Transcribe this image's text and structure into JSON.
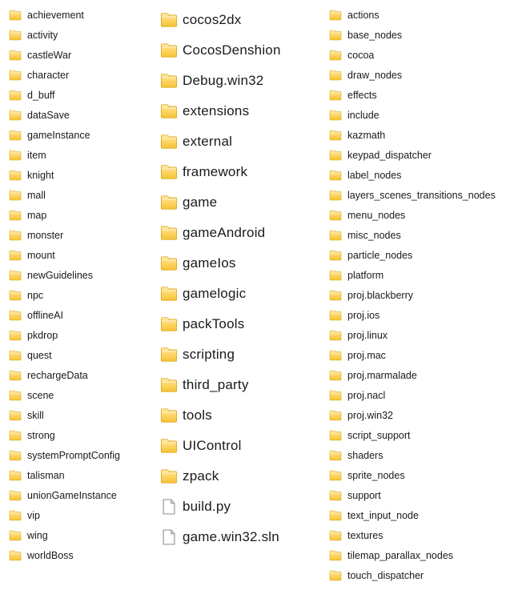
{
  "columns": [
    {
      "id": "col-1",
      "items": [
        {
          "name": "achievement",
          "type": "folder"
        },
        {
          "name": "activity",
          "type": "folder"
        },
        {
          "name": "castleWar",
          "type": "folder"
        },
        {
          "name": "character",
          "type": "folder"
        },
        {
          "name": "d_buff",
          "type": "folder"
        },
        {
          "name": "dataSave",
          "type": "folder"
        },
        {
          "name": "gameInstance",
          "type": "folder"
        },
        {
          "name": "item",
          "type": "folder"
        },
        {
          "name": "knight",
          "type": "folder"
        },
        {
          "name": "mall",
          "type": "folder"
        },
        {
          "name": "map",
          "type": "folder"
        },
        {
          "name": "monster",
          "type": "folder"
        },
        {
          "name": "mount",
          "type": "folder"
        },
        {
          "name": "newGuidelines",
          "type": "folder"
        },
        {
          "name": "npc",
          "type": "folder"
        },
        {
          "name": "offlineAI",
          "type": "folder"
        },
        {
          "name": "pkdrop",
          "type": "folder"
        },
        {
          "name": "quest",
          "type": "folder"
        },
        {
          "name": "rechargeData",
          "type": "folder"
        },
        {
          "name": "scene",
          "type": "folder"
        },
        {
          "name": "skill",
          "type": "folder"
        },
        {
          "name": "strong",
          "type": "folder"
        },
        {
          "name": "systemPromptConfig",
          "type": "folder"
        },
        {
          "name": "talisman",
          "type": "folder"
        },
        {
          "name": "unionGameInstance",
          "type": "folder"
        },
        {
          "name": "vip",
          "type": "folder"
        },
        {
          "name": "wing",
          "type": "folder"
        },
        {
          "name": "worldBoss",
          "type": "folder"
        }
      ]
    },
    {
      "id": "col-2",
      "items": [
        {
          "name": "cocos2dx",
          "type": "folder"
        },
        {
          "name": "CocosDenshion",
          "type": "folder"
        },
        {
          "name": "Debug.win32",
          "type": "folder"
        },
        {
          "name": "extensions",
          "type": "folder"
        },
        {
          "name": "external",
          "type": "folder"
        },
        {
          "name": "framework",
          "type": "folder"
        },
        {
          "name": "game",
          "type": "folder"
        },
        {
          "name": "gameAndroid",
          "type": "folder"
        },
        {
          "name": "gameIos",
          "type": "folder"
        },
        {
          "name": "gamelogic",
          "type": "folder"
        },
        {
          "name": "packTools",
          "type": "folder"
        },
        {
          "name": "scripting",
          "type": "folder"
        },
        {
          "name": "third_party",
          "type": "folder"
        },
        {
          "name": "tools",
          "type": "folder"
        },
        {
          "name": "UIControl",
          "type": "folder"
        },
        {
          "name": "zpack",
          "type": "folder"
        },
        {
          "name": "build.py",
          "type": "file"
        },
        {
          "name": "game.win32.sln",
          "type": "file"
        }
      ]
    },
    {
      "id": "col-3",
      "items": [
        {
          "name": "actions",
          "type": "folder"
        },
        {
          "name": "base_nodes",
          "type": "folder"
        },
        {
          "name": "cocoa",
          "type": "folder"
        },
        {
          "name": "draw_nodes",
          "type": "folder"
        },
        {
          "name": "effects",
          "type": "folder"
        },
        {
          "name": "include",
          "type": "folder"
        },
        {
          "name": "kazmath",
          "type": "folder"
        },
        {
          "name": "keypad_dispatcher",
          "type": "folder"
        },
        {
          "name": "label_nodes",
          "type": "folder"
        },
        {
          "name": "layers_scenes_transitions_nodes",
          "type": "folder"
        },
        {
          "name": "menu_nodes",
          "type": "folder"
        },
        {
          "name": "misc_nodes",
          "type": "folder"
        },
        {
          "name": "particle_nodes",
          "type": "folder"
        },
        {
          "name": "platform",
          "type": "folder"
        },
        {
          "name": "proj.blackberry",
          "type": "folder"
        },
        {
          "name": "proj.ios",
          "type": "folder"
        },
        {
          "name": "proj.linux",
          "type": "folder"
        },
        {
          "name": "proj.mac",
          "type": "folder"
        },
        {
          "name": "proj.marmalade",
          "type": "folder"
        },
        {
          "name": "proj.nacl",
          "type": "folder"
        },
        {
          "name": "proj.win32",
          "type": "folder"
        },
        {
          "name": "script_support",
          "type": "folder"
        },
        {
          "name": "shaders",
          "type": "folder"
        },
        {
          "name": "sprite_nodes",
          "type": "folder"
        },
        {
          "name": "support",
          "type": "folder"
        },
        {
          "name": "text_input_node",
          "type": "folder"
        },
        {
          "name": "textures",
          "type": "folder"
        },
        {
          "name": "tilemap_parallax_nodes",
          "type": "folder"
        },
        {
          "name": "touch_dispatcher",
          "type": "folder"
        }
      ]
    }
  ]
}
